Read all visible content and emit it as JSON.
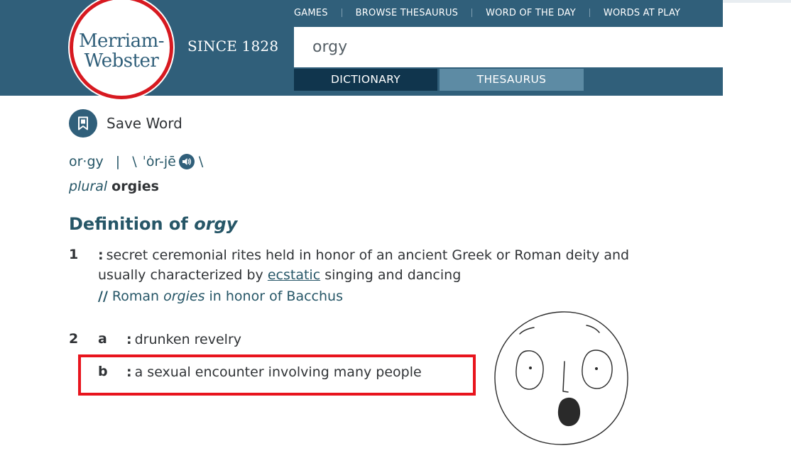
{
  "header": {
    "logo": {
      "line1": "Merriam-",
      "line2": "Webster"
    },
    "tagline": "SINCE 1828",
    "nav": [
      "GAMES",
      "BROWSE THESAURUS",
      "WORD OF THE DAY",
      "WORDS AT PLAY"
    ],
    "search": {
      "value": "orgy"
    },
    "tabs": {
      "dictionary": "DICTIONARY",
      "thesaurus": "THESAURUS"
    }
  },
  "colors": {
    "header_bg": "#305f7a",
    "logo_ring": "#d71920",
    "active_tab": "#10354d",
    "inactive_tab": "#5d8ba4",
    "link": "#265667",
    "highlight": "#e8141d"
  },
  "entry": {
    "save_label": "Save Word",
    "syllables": "or·gy",
    "separator": "|",
    "pron_open": "\\",
    "pronunciation": "ˈȯr-jē",
    "pron_close": "\\",
    "plural_label": "plural",
    "plural_form": "orgies",
    "definition_label": "Definition of",
    "headword": "orgy"
  },
  "senses": {
    "s1": {
      "number": "1",
      "colon": ":",
      "text_before": "secret ceremonial rites held in honor of an ancient Greek or Roman deity and",
      "text_line2_before": "usually characterized by",
      "xref": "ecstatic",
      "text_after": "singing and dancing",
      "example": {
        "slashes": "//",
        "before": "Roman",
        "emphasis": "orgies",
        "after": "in honor of Bacchus"
      }
    },
    "s2": {
      "number": "2",
      "a": {
        "letter": "a",
        "colon": ":",
        "text": "drunken revelry"
      },
      "b": {
        "letter": "b",
        "colon": ":",
        "text": "a sexual encounter involving many people"
      }
    }
  },
  "icons": {
    "save": "bookmark-icon",
    "audio": "speaker-icon",
    "drawing": "shocked-face-drawing"
  }
}
